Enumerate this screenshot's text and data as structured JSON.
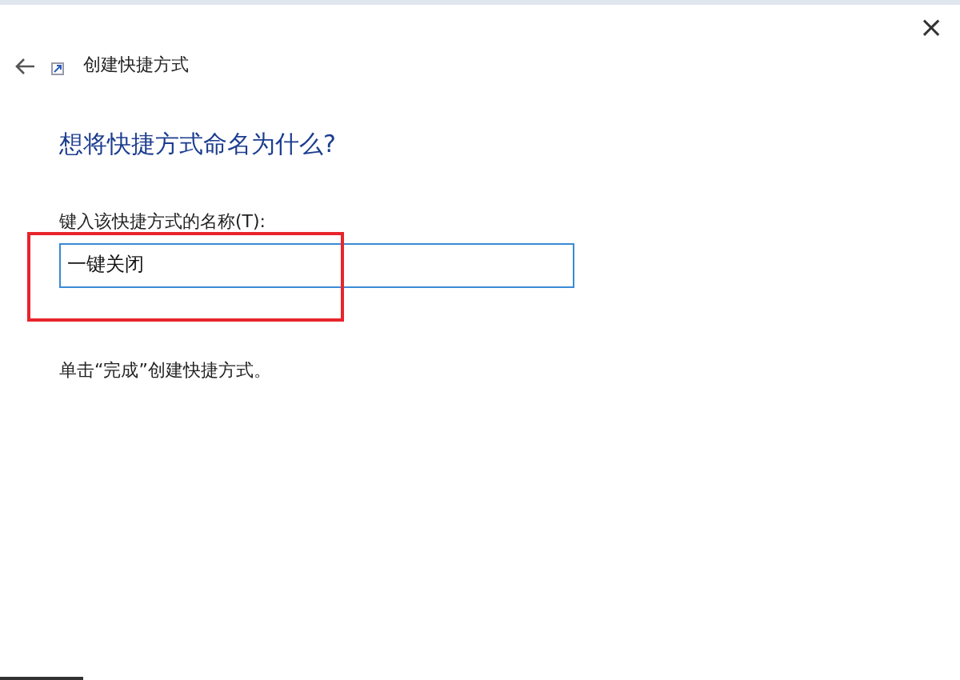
{
  "window": {
    "title": "创建快捷方式",
    "close": "×"
  },
  "heading": "想将快捷方式命名为什么?",
  "name_field": {
    "label": "键入该快捷方式的名称(T):",
    "value": "一键关闭"
  },
  "instruction": "单击“完成”创建快捷方式。"
}
